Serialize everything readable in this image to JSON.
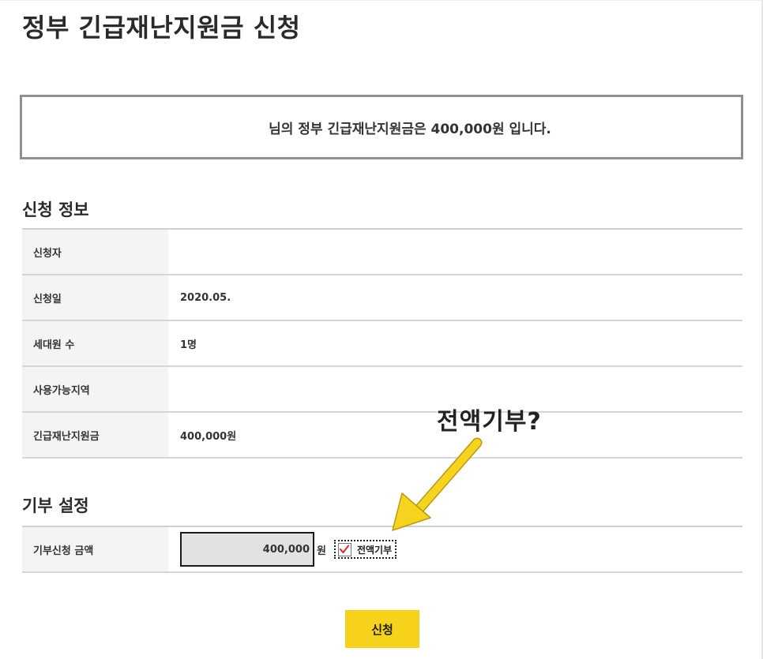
{
  "page": {
    "title": "정부 긴급재난지원금 신청"
  },
  "notice": {
    "text": "님의 정부 긴급재난지원금은 400,000원 입니다."
  },
  "application_info": {
    "section_title": "신청 정보",
    "rows": [
      {
        "label": "신청자",
        "value": ""
      },
      {
        "label": "신청일",
        "value": "2020.05."
      },
      {
        "label": "세대원 수",
        "value": "1명"
      },
      {
        "label": "사용가능지역",
        "value": ""
      },
      {
        "label": "긴급재난지원금",
        "value": "400,000원"
      }
    ]
  },
  "donation": {
    "section_title": "기부 설정",
    "amount_label": "기부신청 금액",
    "amount_value": "400,000",
    "unit": "원",
    "all_donate_label": "전액기부",
    "all_donate_checked": true
  },
  "submit": {
    "label": "신청"
  },
  "annotation": {
    "text": "전액기부?"
  },
  "colors": {
    "accent": "#f7d21c",
    "arrow": "#f5d31e",
    "check": "#d23a3a",
    "header_cell": "#f4f4f5"
  },
  "icons": {
    "checkbox": "checkmark-icon",
    "arrow": "arrow-icon"
  }
}
